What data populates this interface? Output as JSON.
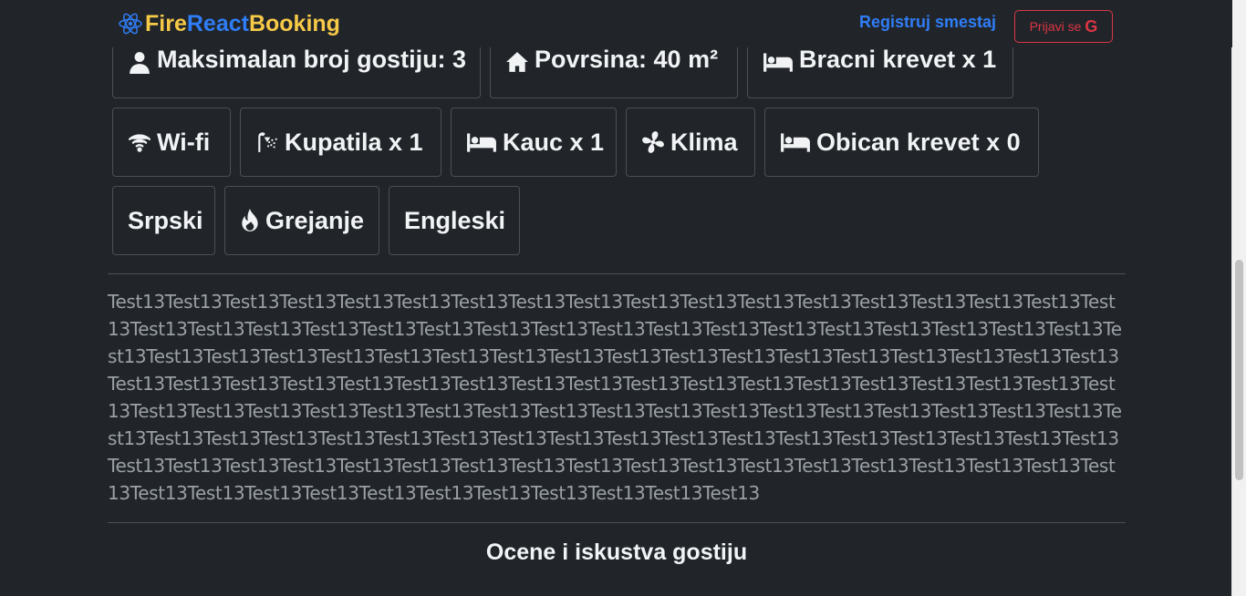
{
  "navbar": {
    "brand_fire": "Fire",
    "brand_react": "React",
    "brand_booking": "Booking",
    "register_link": "Registruj smestaj",
    "login_button": "Prijavi se",
    "login_icon": "G"
  },
  "amenities": {
    "max_guests": "Maksimalan broj gostiju: 3",
    "area": "Povrsina: 40 m²",
    "double_bed": "Bracni krevet x 1",
    "wifi": "Wi-fi",
    "bathrooms": "Kupatila x 1",
    "couch": "Kauc x 1",
    "ac": "Klima",
    "single_bed": "Obican krevet x 0",
    "serbian": "Srpski",
    "heating": "Grejanje",
    "english": "Engleski"
  },
  "description": "Test13Test13Test13Test13Test13Test13Test13Test13Test13Test13Test13Test13Test13Test13Test13Test13Test13Test13Test13Test13Test13Test13Test13Test13Test13Test13Test13Test13Test13Test13Test13Test13Test13Test13Test13Test13Test13Test13Test13Test13Test13Test13Test13Test13Test13Test13Test13Test13Test13Test13Test13Test13Test13Test13Test13Test13Test13Test13Test13Test13Test13Test13Test13Test13Test13Test13Test13Test13Test13Test13Test13Test13Test13Test13Test13Test13Test13Test13Test13Test13Test13Test13Test13Test13Test13Test13Test13Test13Test13Test13Test13Test13Test13Test13Test13Test13Test13Test13Test13Test13Test13Test13Test13Test13Test13Test13Test13Test13Test13Test13Test13Test13Test13Test13Test13Test13Test13Test13Test13Test13Test13Test13Test13Test13Test13Test13Test13Test13Test13Test13Test13Test13Test13Test13Test13",
  "reviews": {
    "title": "Ocene i iskustva gostiju"
  }
}
